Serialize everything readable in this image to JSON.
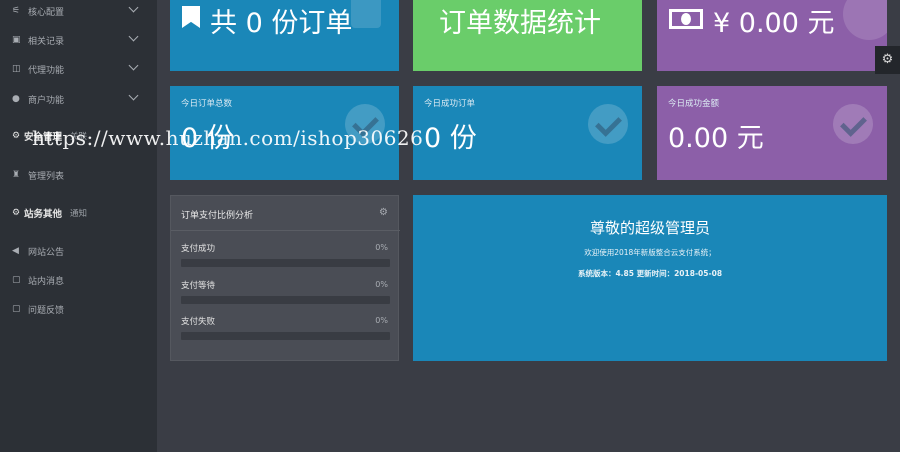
{
  "sidebar": {
    "items": [
      {
        "icon": "sliders-icon",
        "glyph": "⚟",
        "label": "核心配置",
        "has_chevron": true
      },
      {
        "icon": "record-icon",
        "glyph": "▣",
        "label": "相关记录",
        "has_chevron": true
      },
      {
        "icon": "proxy-icon",
        "glyph": "◫",
        "label": "代理功能",
        "has_chevron": true
      },
      {
        "icon": "user-icon",
        "glyph": "●",
        "label": "商户功能",
        "has_chevron": true
      }
    ],
    "group1": {
      "title": "安全管理",
      "sub": "关联"
    },
    "manage_list": {
      "glyph": "♜",
      "label": "管理列表"
    },
    "group2": {
      "title": "站务其他",
      "sub": "通知"
    },
    "items2": [
      {
        "icon": "speaker-icon",
        "glyph": "◀",
        "label": "网站公告"
      },
      {
        "icon": "message-icon",
        "glyph": "▢",
        "label": "站内消息"
      },
      {
        "icon": "feedback-icon",
        "glyph": "▢",
        "label": "问题反馈"
      }
    ]
  },
  "top_cards": {
    "orders": "共 0 份订单",
    "stats": "订单数据统计",
    "amount": "¥ 0.00 元"
  },
  "stat_cards": [
    {
      "label": "今日订单总数",
      "value": "0 份"
    },
    {
      "label": "今日成功订单",
      "value": "0 份"
    },
    {
      "label": "今日成功金额",
      "value": "0.00 元"
    }
  ],
  "analysis": {
    "title": "订单支付比例分析",
    "rows": [
      {
        "label": "支付成功",
        "percent": "0%",
        "fraction": 0
      },
      {
        "label": "支付等待",
        "percent": "0%",
        "fraction": 0
      },
      {
        "label": "支付失败",
        "percent": "0%",
        "fraction": 0
      }
    ]
  },
  "welcome": {
    "title": "尊敬的超级管理员",
    "line1": "欢迎使用2018年新版整合云支付系统；",
    "line2": "系统版本：4.85 更新时间：2018-05-08"
  },
  "watermark": "https://www.huzhan.com/ishop30626",
  "colors": {
    "blue": "#1a87b8",
    "green": "#6acd6a",
    "purple": "#8c5fa8",
    "sidebar": "#2c3036"
  }
}
